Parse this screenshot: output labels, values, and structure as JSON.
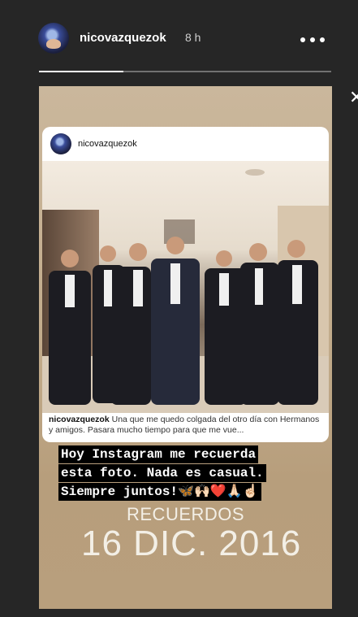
{
  "header": {
    "username": "nicovazquezok",
    "time": "8 h",
    "progress_fraction": 0.29
  },
  "post": {
    "username": "nicovazquezok",
    "caption_username": "nicovazquezok",
    "caption_text": " Una que me quedo colgada del otro día con Hermanos y amigos. Pasara mucho tiempo para que me vue..."
  },
  "story": {
    "text_lines": [
      "Hoy Instagram me recuerda",
      "esta foto. Nada es casual.",
      "Siempre juntos!🦋🙌🏻❤️🙏🏻☝🏻"
    ],
    "sticker_label": "RECUERDOS",
    "sticker_date": "16 DIC. 2016"
  },
  "icons": {
    "more": "more-options-icon",
    "close": "close-icon"
  }
}
